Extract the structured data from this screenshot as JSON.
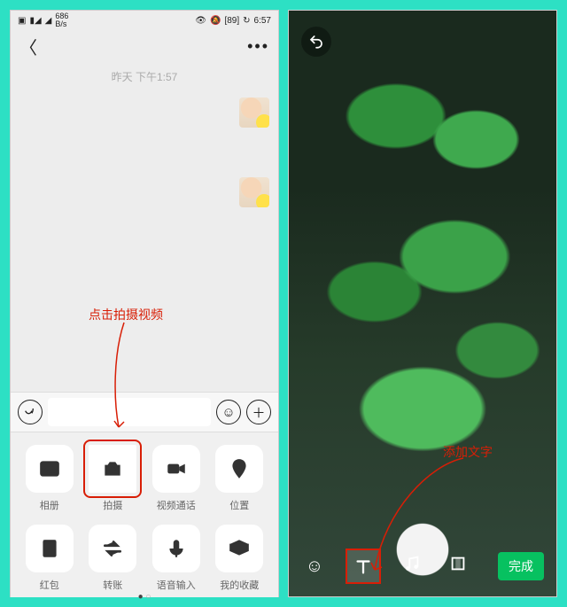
{
  "left": {
    "statusbar": {
      "net_speed": "686",
      "net_unit": "B/s",
      "battery": "89",
      "time": "6:57"
    },
    "chat": {
      "timestamp": "昨天 下午1:57"
    },
    "annotation": "点击拍摄视频",
    "attachments": {
      "row1": [
        {
          "key": "album",
          "label": "相册"
        },
        {
          "key": "camera",
          "label": "拍摄"
        },
        {
          "key": "video_call",
          "label": "视频通话"
        },
        {
          "key": "location",
          "label": "位置"
        }
      ],
      "row2": [
        {
          "key": "red_packet",
          "label": "红包"
        },
        {
          "key": "transfer",
          "label": "转账"
        },
        {
          "key": "voice_input",
          "label": "语音输入"
        },
        {
          "key": "favorites",
          "label": "我的收藏"
        }
      ]
    }
  },
  "right": {
    "annotation": "添加文字",
    "done_label": "完成",
    "tools": {
      "emoji": "emoji",
      "text": "text",
      "music": "music",
      "crop": "crop"
    }
  }
}
